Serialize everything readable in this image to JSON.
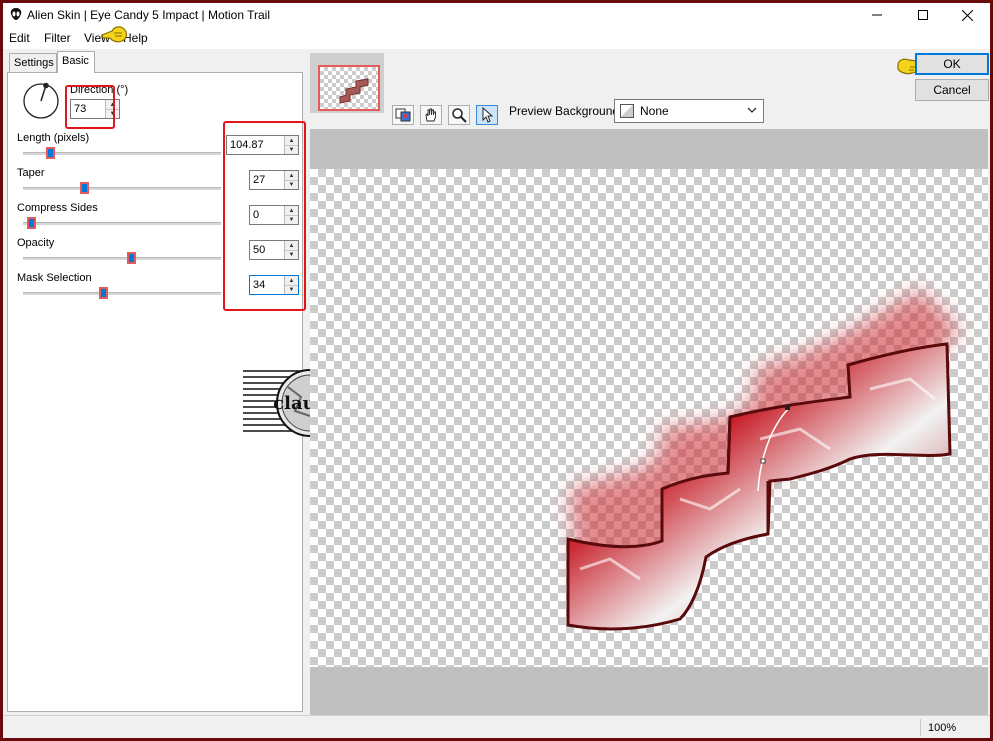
{
  "window": {
    "title": "Alien Skin | Eye Candy 5 Impact | Motion Trail",
    "controls": [
      "minimize-icon",
      "maximize-icon",
      "close-icon"
    ]
  },
  "menu": {
    "items": [
      "Edit",
      "Filter",
      "View",
      "Help"
    ]
  },
  "tabs": [
    "Settings",
    "Basic"
  ],
  "direction": {
    "label": "Direction (°)",
    "value": "73"
  },
  "params": [
    {
      "label": "Length (pixels)",
      "value": "104.87",
      "slider_fraction": 0.12
    },
    {
      "label": "Taper",
      "value": "27",
      "slider_fraction": 0.3
    },
    {
      "label": "Compress Sides",
      "value": "0",
      "slider_fraction": 0.02
    },
    {
      "label": "Opacity",
      "value": "50",
      "slider_fraction": 0.55
    },
    {
      "label": "Mask Selection",
      "value": "34",
      "slider_fraction": 0.4
    }
  ],
  "watermark": {
    "text": "claudia"
  },
  "toolbar": {
    "tools": [
      "preview-toggle-icon",
      "hand-icon",
      "zoom-icon",
      "arrow-icon"
    ],
    "preview_background_label": "Preview Background:",
    "preview_background_value": "None"
  },
  "buttons": {
    "ok": "OK",
    "cancel": "Cancel"
  },
  "status": {
    "zoom": "100%"
  },
  "colors": {
    "accent": "#0078d7",
    "highlight_box": "#e0161c",
    "frame": "#6b0a0a"
  }
}
